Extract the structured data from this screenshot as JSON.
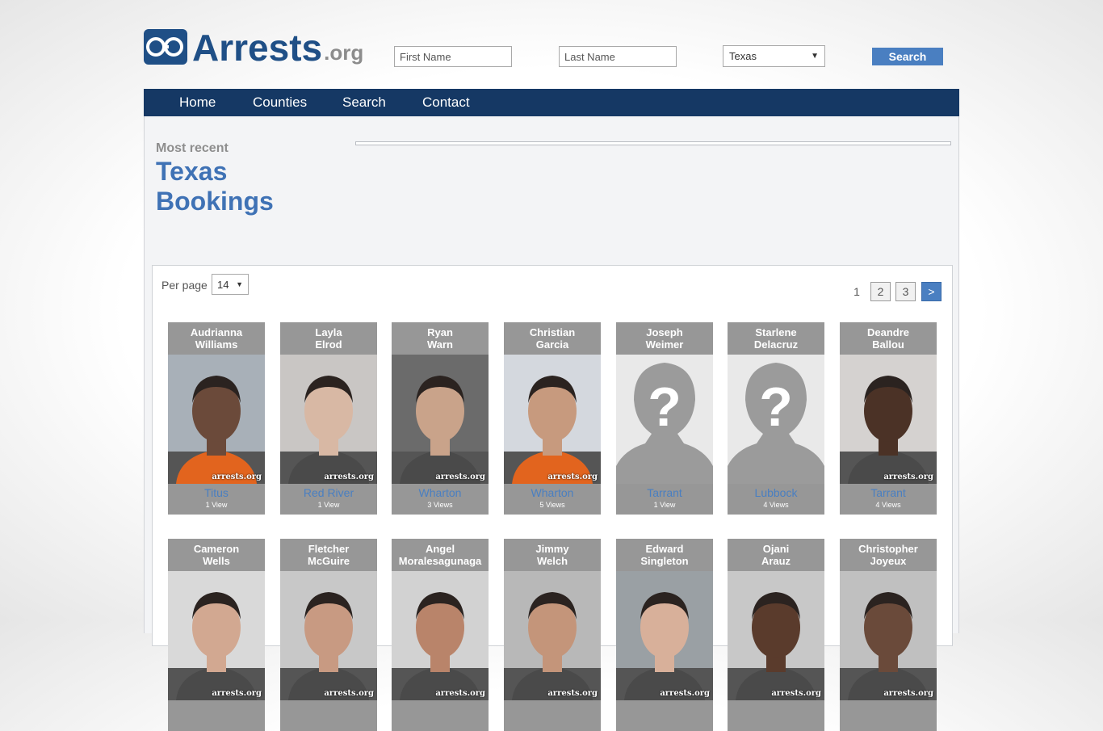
{
  "header": {
    "logo_word": "Arrests",
    "logo_tld": ".org",
    "first_name_placeholder": "First Name",
    "last_name_placeholder": "Last Name",
    "state_value": "Texas",
    "search_label": "Search"
  },
  "nav": [
    "Home",
    "Counties",
    "Search",
    "Contact"
  ],
  "page": {
    "subtitle": "Most recent",
    "title_line1": "Texas",
    "title_line2": "Bookings"
  },
  "controls": {
    "per_page_label": "Per page",
    "per_page_value": "14",
    "pages": [
      "1",
      "2",
      "3"
    ],
    "next_label": ">"
  },
  "watermark": "arrests.org",
  "bookings": [
    {
      "first": "Audrianna",
      "last": "Williams",
      "county": "Titus",
      "views": "1 View",
      "photo": true
    },
    {
      "first": "Layla",
      "last": "Elrod",
      "county": "Red River",
      "views": "1 View",
      "photo": true
    },
    {
      "first": "Ryan",
      "last": "Warn",
      "county": "Wharton",
      "views": "3 Views",
      "photo": true
    },
    {
      "first": "Christian",
      "last": "Garcia",
      "county": "Wharton",
      "views": "5 Views",
      "photo": true
    },
    {
      "first": "Joseph",
      "last": "Weimer",
      "county": "Tarrant",
      "views": "1 View",
      "photo": false
    },
    {
      "first": "Starlene",
      "last": "Delacruz",
      "county": "Lubbock",
      "views": "4 Views",
      "photo": false
    },
    {
      "first": "Deandre",
      "last": "Ballou",
      "county": "Tarrant",
      "views": "4 Views",
      "photo": true
    },
    {
      "first": "Cameron",
      "last": "Wells",
      "county": "",
      "views": "",
      "photo": true
    },
    {
      "first": "Fletcher",
      "last": "McGuire",
      "county": "",
      "views": "",
      "photo": true
    },
    {
      "first": "Angel",
      "last": "Moralesagunaga",
      "county": "",
      "views": "",
      "photo": true
    },
    {
      "first": "Jimmy",
      "last": "Welch",
      "county": "",
      "views": "",
      "photo": true
    },
    {
      "first": "Edward",
      "last": "Singleton",
      "county": "",
      "views": "",
      "photo": true
    },
    {
      "first": "Ojani",
      "last": "Arauz",
      "county": "",
      "views": "",
      "photo": true
    },
    {
      "first": "Christopher",
      "last": "Joyeux",
      "county": "",
      "views": "",
      "photo": true
    }
  ]
}
